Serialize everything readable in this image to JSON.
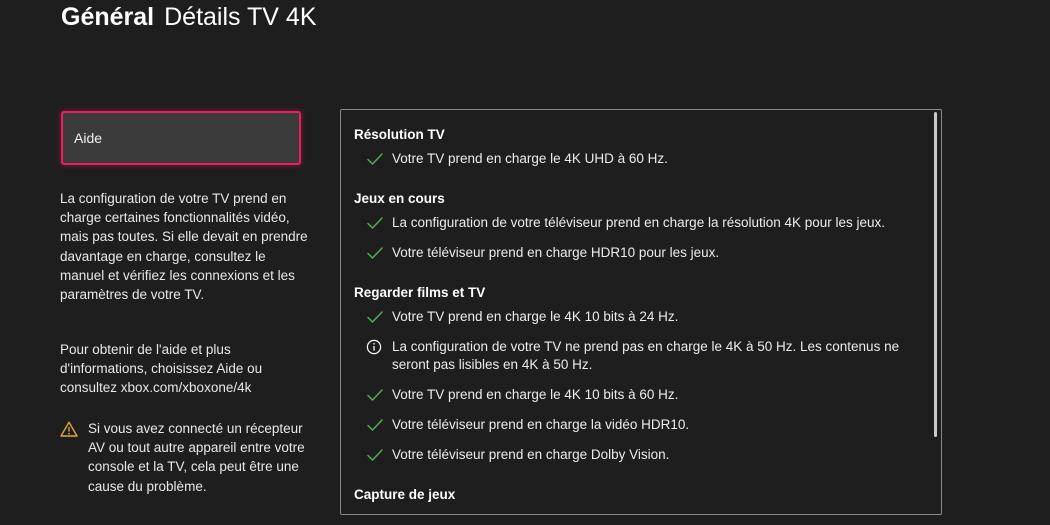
{
  "header": {
    "section": "Général",
    "subtitle": "Détails TV 4K"
  },
  "help_button": {
    "label": "Aide"
  },
  "sidebar": {
    "paragraph1": "La configuration de votre TV prend en charge certaines fonctionnalités vidéo, mais pas toutes. Si elle devait en prendre davantage en charge, consultez le manuel et vérifiez les connexions et les paramètres de votre TV.",
    "paragraph2": "Pour obtenir de l'aide et plus d'informations, choisissez Aide ou consultez xbox.com/xboxone/4k",
    "warning": "Si vous avez connecté un récepteur AV ou tout autre appareil entre votre console et la TV, cela peut être une cause du problème."
  },
  "groups": [
    {
      "title": "Résolution TV",
      "items": [
        {
          "icon": "check-icon",
          "text": "Votre TV prend en charge le 4K UHD à 60 Hz."
        }
      ]
    },
    {
      "title": "Jeux en cours",
      "items": [
        {
          "icon": "check-icon",
          "text": "La configuration de votre téléviseur prend en charge la résolution 4K pour les jeux."
        },
        {
          "icon": "check-icon",
          "text": "Votre téléviseur prend en charge HDR10 pour les jeux."
        }
      ]
    },
    {
      "title": "Regarder films et TV",
      "items": [
        {
          "icon": "check-icon",
          "text": "Votre TV prend en charge le 4K 10 bits à 24 Hz."
        },
        {
          "icon": "info-icon",
          "text": "La configuration de votre TV ne prend pas en charge le 4K à 50 Hz. Les contenus ne seront pas lisibles en 4K à 50 Hz."
        },
        {
          "icon": "check-icon",
          "text": "Votre TV prend en charge le 4K 10 bits à 60 Hz."
        },
        {
          "icon": "check-icon",
          "text": "Votre téléviseur prend en charge la vidéo HDR10."
        },
        {
          "icon": "check-icon",
          "text": "Votre téléviseur prend en charge Dolby Vision."
        }
      ]
    },
    {
      "title": "Capture de jeux",
      "items": []
    }
  ],
  "colors": {
    "background": "#1e1e1e",
    "focus_border": "#e0245e",
    "check": "#4caf50",
    "warning": "#e8a33d"
  }
}
